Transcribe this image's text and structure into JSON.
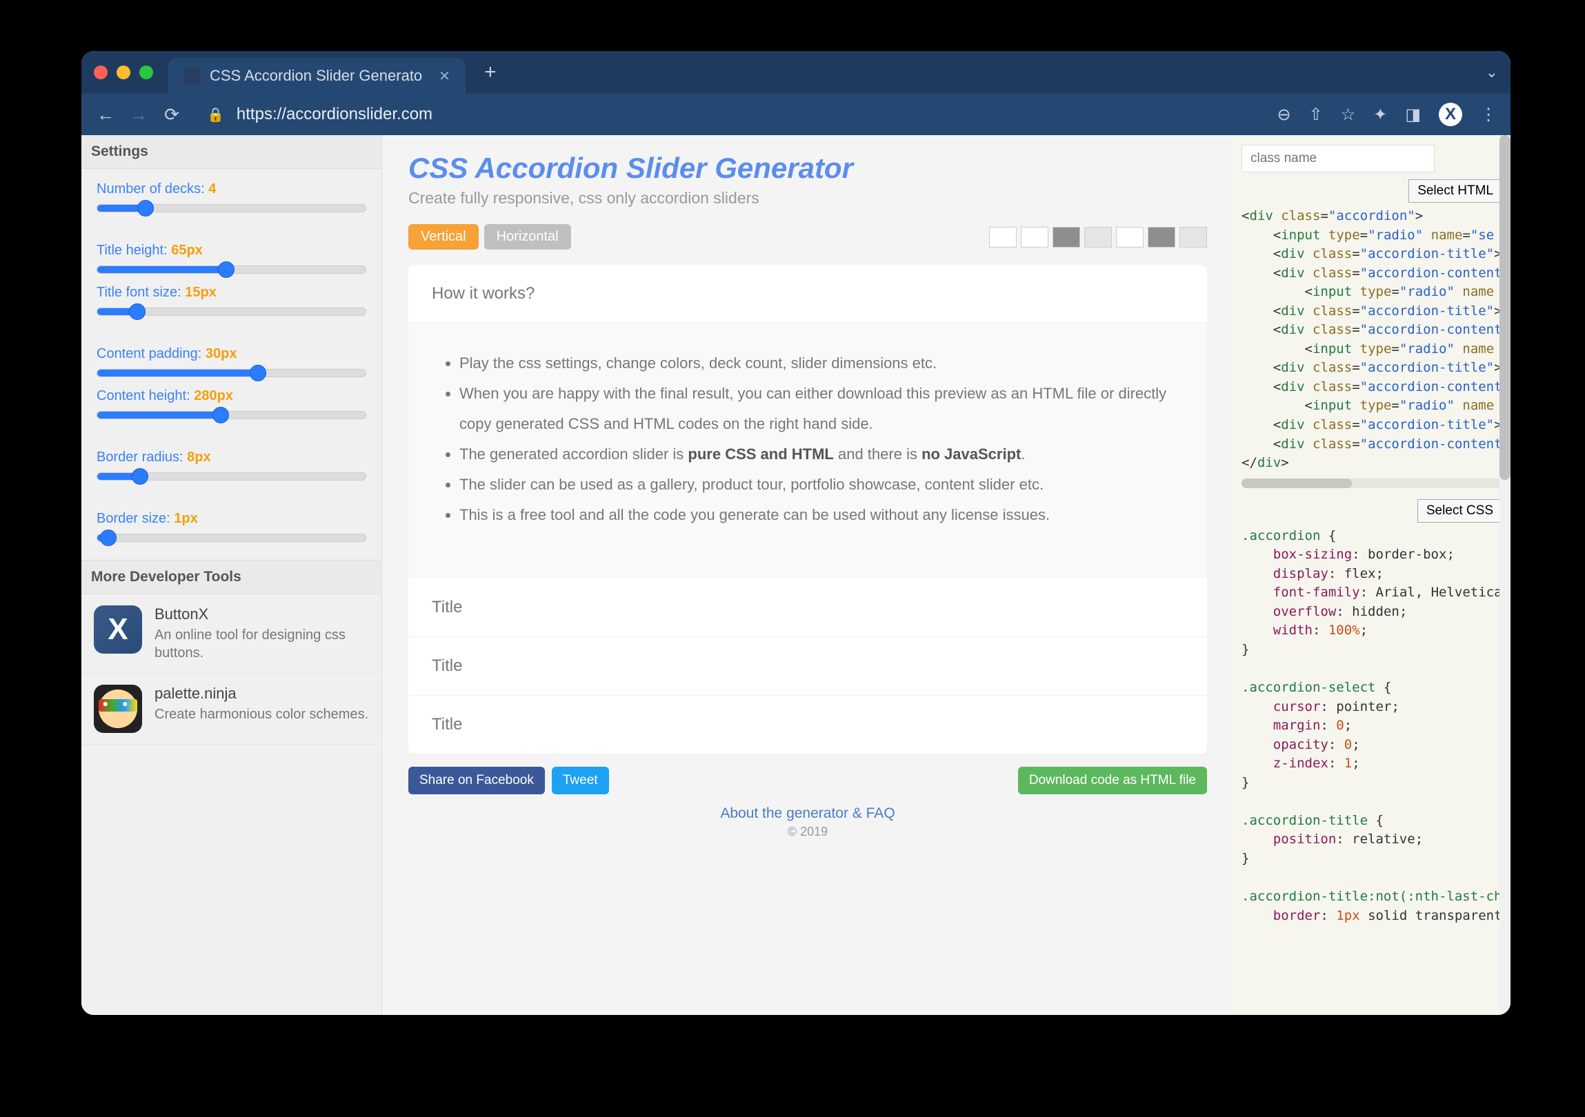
{
  "browser": {
    "tab_title": "CSS Accordion Slider Generato",
    "url": "https://accordionslider.com"
  },
  "sidebar": {
    "heading": "Settings",
    "sliders": [
      {
        "label": "Number of decks:",
        "value": "4",
        "pct": 18
      },
      {
        "label": "Title height:",
        "value": "65px",
        "pct": 48
      },
      {
        "label": "Title font size:",
        "value": "15px",
        "pct": 15
      },
      {
        "label": "Content padding:",
        "value": "30px",
        "pct": 60
      },
      {
        "label": "Content height:",
        "value": "280px",
        "pct": 46
      },
      {
        "label": "Border radius:",
        "value": "8px",
        "pct": 16
      },
      {
        "label": "Border size:",
        "value": "1px",
        "pct": 4
      }
    ],
    "tools_heading": "More Developer Tools",
    "tools": [
      {
        "name": "ButtonX",
        "desc": "An online tool for designing css buttons."
      },
      {
        "name": "palette.ninja",
        "desc": "Create harmonious color schemes."
      }
    ]
  },
  "main": {
    "title": "CSS Accordion Slider Generator",
    "subtitle": "Create fully responsive, css only accordion sliders",
    "tab_vertical": "Vertical",
    "tab_horizontal": "Horizontal",
    "swatches": [
      "#ffffff",
      "#ffffff",
      "#8e8e8e",
      "#e5e5e5",
      "#ffffff",
      "#8e8e8e",
      "#e5e5e5"
    ],
    "how_title": "How it works?",
    "bullets": [
      "Play the css settings, change colors, deck count, slider dimensions etc.",
      "When you are happy with the final result, you can either download this preview as an HTML file or directly copy generated CSS and HTML codes on the right hand side.",
      "The generated accordion slider is <b>pure CSS and HTML</b> and there is <b>no JavaScript</b>.",
      "The slider can be used as a gallery, product tour, portfolio showcase, content slider etc.",
      "This is a free tool and all the code you generate can be used without any license issues."
    ],
    "deck_titles": [
      "Title",
      "Title",
      "Title"
    ],
    "share_fb": "Share on Facebook",
    "share_tw": "Tweet",
    "download": "Download code as HTML file",
    "footer_link": "About the generator & FAQ",
    "footer_copy": "© 2019"
  },
  "code": {
    "classname_placeholder": "class name",
    "select_html": "Select HTML",
    "select_css": "Select CSS"
  }
}
